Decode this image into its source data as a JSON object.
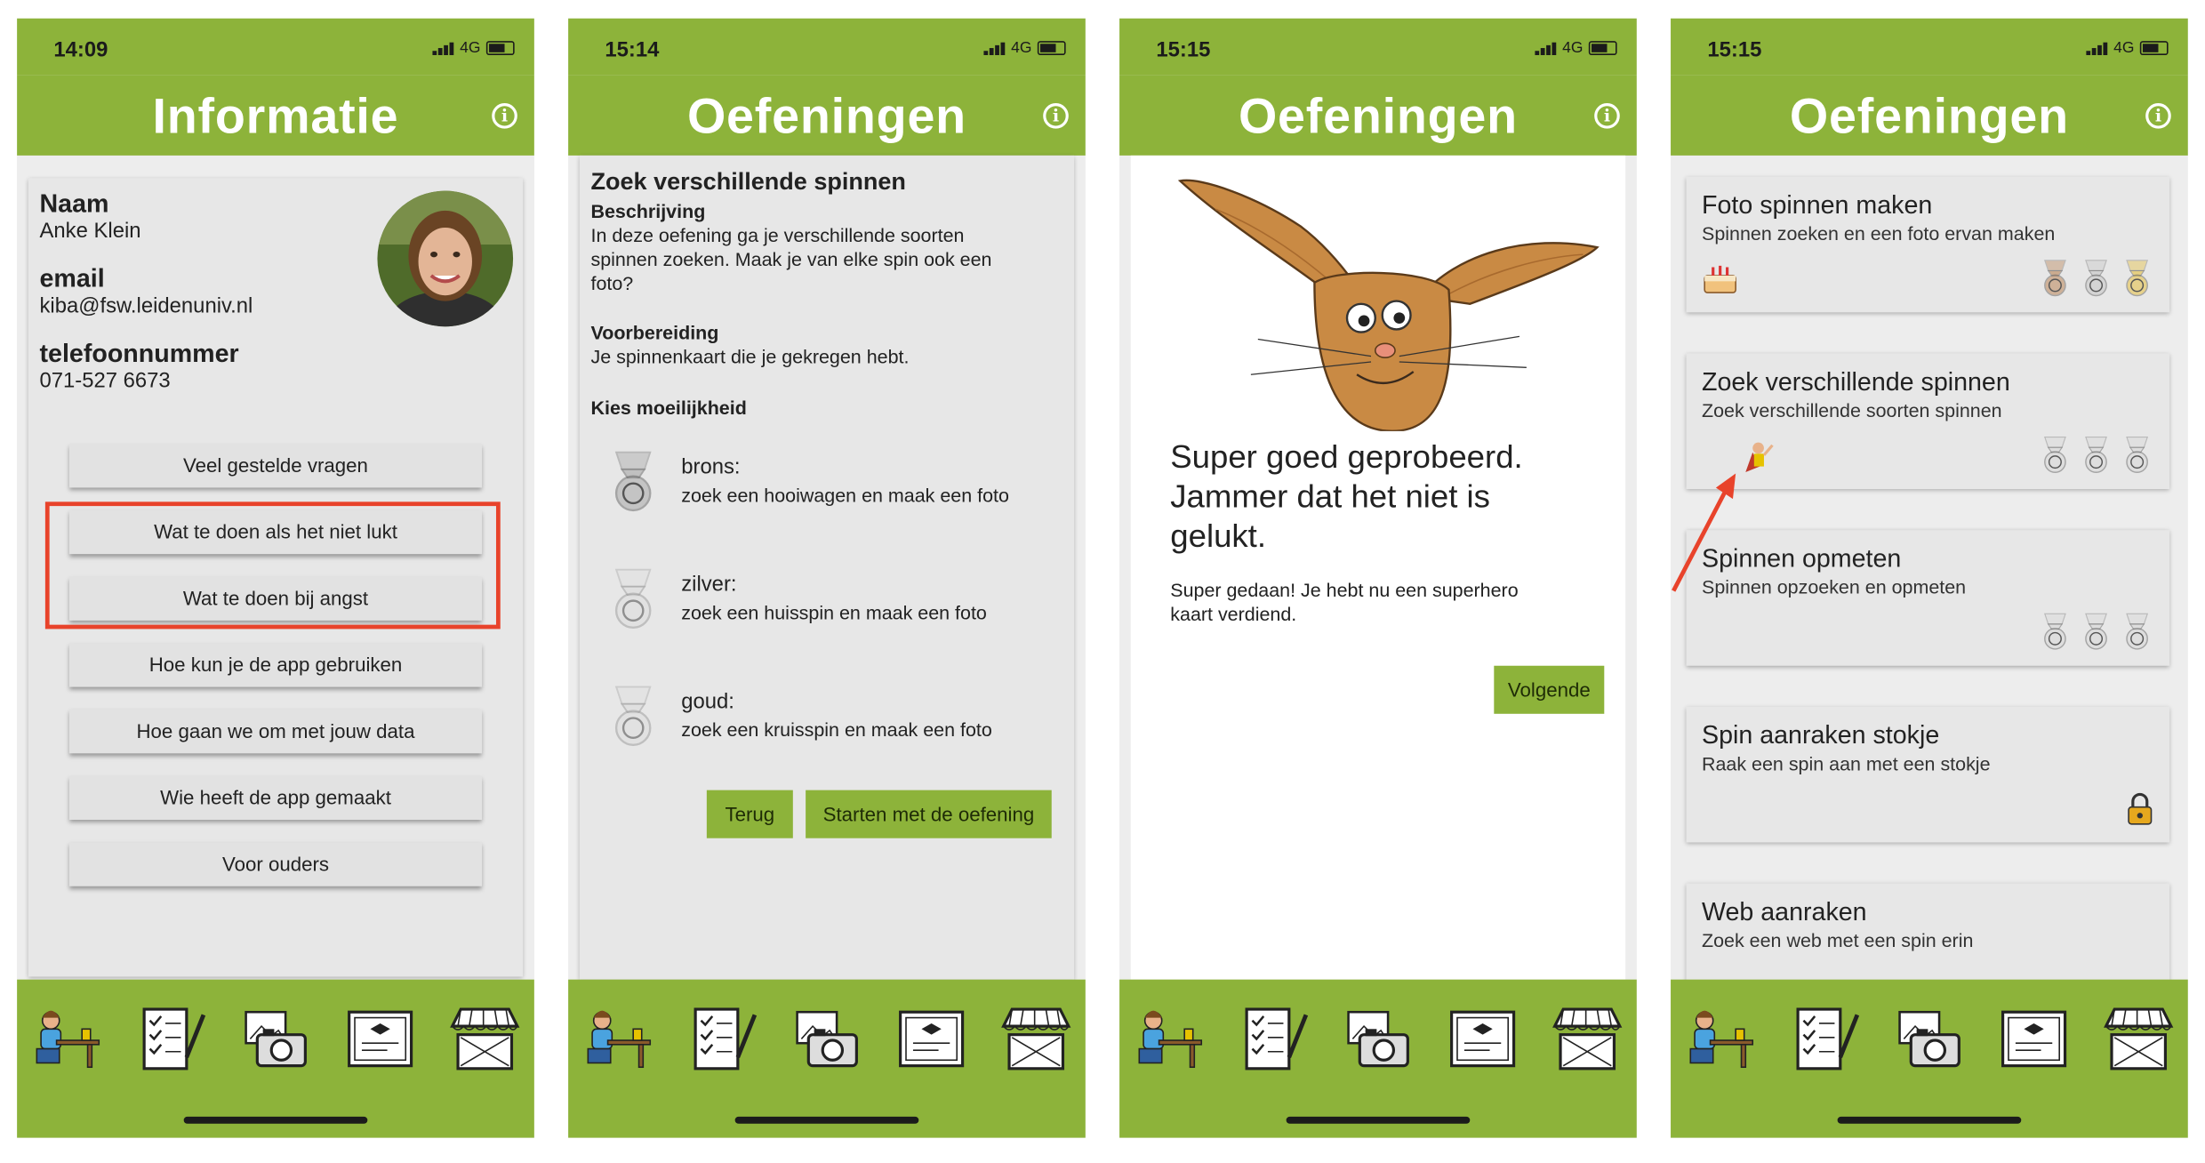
{
  "screens": [
    {
      "status": {
        "time": "14:09",
        "network": "4G"
      },
      "header": {
        "title": "Informatie"
      },
      "profile": {
        "name_label": "Naam",
        "name": "Anke Klein",
        "email_label": "email",
        "email": "kiba@fsw.leidenuniv.nl",
        "phone_label": "telefoonnummer",
        "phone": "071-527 6673"
      },
      "buttons": [
        {
          "label": "Veel gestelde vragen"
        },
        {
          "label": "Wat te doen als het niet lukt"
        },
        {
          "label": "Wat te doen bij angst"
        },
        {
          "label": "Hoe kun je de app gebruiken"
        },
        {
          "label": "Hoe gaan we om met jouw data"
        },
        {
          "label": "Wie heeft de app gemaakt"
        },
        {
          "label": "Voor ouders"
        }
      ],
      "highlight_color": "#e8432b"
    },
    {
      "status": {
        "time": "15:14",
        "network": "4G"
      },
      "header": {
        "title": "Oefeningen"
      },
      "exercise": {
        "title": "Zoek verschillende spinnen",
        "desc_label": "Beschrijving",
        "desc_lines": [
          "In deze oefening ga je verschillende soorten",
          "spinnen zoeken. Maak je van elke spin ook een",
          "foto?"
        ],
        "prep_label": "Voorbereiding",
        "prep": "Je spinnenkaart die je gekregen hebt.",
        "difficulty_label": "Kies moeilijkheid",
        "levels": [
          {
            "name": "brons:",
            "task": "zoek een hooiwagen en maak een foto"
          },
          {
            "name": "zilver:",
            "task": "zoek een huisspin en maak een foto"
          },
          {
            "name": "goud:",
            "task": "zoek een kruisspin en maak een foto"
          }
        ],
        "back_label": "Terug",
        "start_label": "Starten met de oefening"
      }
    },
    {
      "status": {
        "time": "15:15",
        "network": "4G"
      },
      "header": {
        "title": "Oefeningen"
      },
      "result": {
        "heading_lines": [
          "Super goed geprobeerd.",
          "Jammer dat het niet is",
          "gelukt."
        ],
        "body_lines": [
          "Super gedaan! Je hebt nu een superhero",
          "kaart verdiend."
        ],
        "next_label": "Volgende"
      }
    },
    {
      "status": {
        "time": "15:15",
        "network": "4G"
      },
      "header": {
        "title": "Oefeningen"
      },
      "exercises": [
        {
          "title": "Foto spinnen maken",
          "subtitle": "Spinnen zoeken en een foto ervan maken",
          "badge": "cake-icon",
          "medals": [
            "bronze",
            "silver",
            "gold"
          ]
        },
        {
          "title": "Zoek verschillende spinnen",
          "subtitle": "Zoek verschillende soorten spinnen",
          "badge": "superhero-icon",
          "medals": [
            "grey",
            "grey",
            "grey"
          ]
        },
        {
          "title": "Spinnen opmeten",
          "subtitle": "Spinnen opzoeken en opmeten",
          "badge": "",
          "medals": [
            "grey",
            "grey",
            "grey"
          ]
        },
        {
          "title": "Spin aanraken stokje",
          "subtitle": "Raak een spin aan met een stokje",
          "badge": "lock-icon",
          "medals": []
        },
        {
          "title": "Web aanraken",
          "subtitle": "Zoek een web met een spin erin",
          "badge": "",
          "medals": []
        }
      ]
    }
  ],
  "nav": [
    "student-at-desk-icon",
    "checklist-icon",
    "camera-icon",
    "certificate-icon",
    "market-stall-icon"
  ],
  "colors": {
    "brand_green": "#8db33a",
    "card": "#e7e7e7",
    "annotation_red": "#e8432b"
  }
}
